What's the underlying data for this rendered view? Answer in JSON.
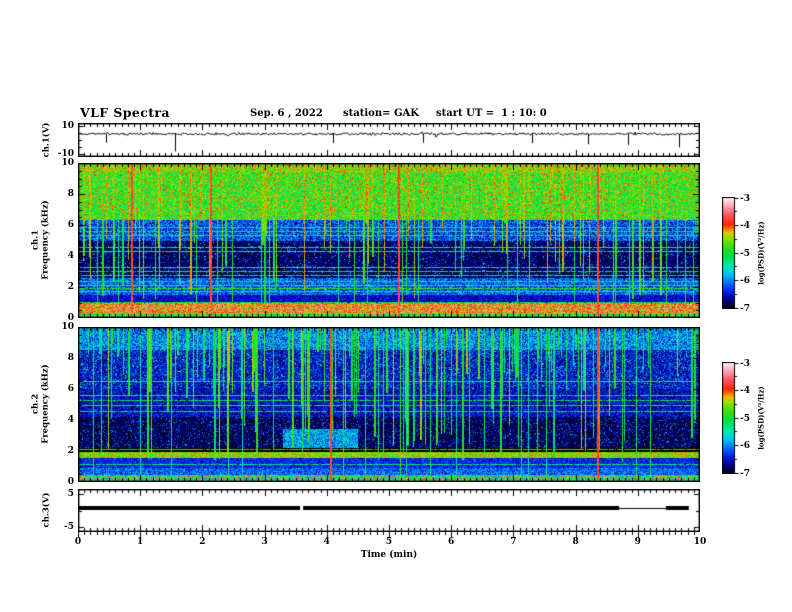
{
  "title": {
    "main": "VLF Spectra",
    "date": "Sep. 6 , 2022",
    "station": "station= GAK",
    "start_ut": "start UT =  1 : 10: 0"
  },
  "x_axis": {
    "label": "Time (min)",
    "ticks": [
      "0",
      "1",
      "2",
      "3",
      "4",
      "5",
      "6",
      "7",
      "8",
      "9",
      "10"
    ],
    "range_min": [
      0,
      10
    ],
    "minor_step_min": 0.1
  },
  "panels": [
    {
      "name": "ch.1 voltage waveform",
      "ylabel": "ch.1(V)",
      "yticks": [
        "10",
        "-10"
      ],
      "y_range": [
        -10,
        10
      ]
    },
    {
      "name": "ch.1 spectrogram",
      "ylabel_line1": "ch.1",
      "ylabel_line2": "Frequency (kHz)",
      "yticks": [
        "10",
        "8",
        "6",
        "4",
        "2",
        "0"
      ],
      "y_range_khz": [
        0,
        10
      ]
    },
    {
      "name": "ch.2 spectrogram",
      "ylabel_line1": "ch.2",
      "ylabel_line2": "Frequency (kHz)",
      "yticks": [
        "10",
        "8",
        "6",
        "4",
        "2",
        "0"
      ],
      "y_range_khz": [
        0,
        10
      ]
    },
    {
      "name": "ch.3 voltage",
      "ylabel": "ch.3(V)",
      "yticks": [
        "5",
        "-5"
      ],
      "y_range": [
        -5,
        5
      ]
    }
  ],
  "colorbars": [
    {
      "label": "log(PSD)(V²/Hz)",
      "ticks": [
        "-3",
        "-4",
        "-5",
        "-6",
        "-7"
      ],
      "range": [
        -7,
        -3
      ]
    },
    {
      "label": "log(PSD)(V²/Hz)",
      "ticks": [
        "-3",
        "-4",
        "-5",
        "-6",
        "-7"
      ],
      "range": [
        -7,
        -3
      ]
    }
  ],
  "colormap": [
    {
      "v": -7.05,
      "c": "#000005"
    },
    {
      "v": -7.0,
      "c": "#000014"
    },
    {
      "v": -6.75,
      "c": "#000080"
    },
    {
      "v": -6.45,
      "c": "#0018e0"
    },
    {
      "v": -6.1,
      "c": "#0070f8"
    },
    {
      "v": -5.8,
      "c": "#00c0f0"
    },
    {
      "v": -5.5,
      "c": "#00e8b0"
    },
    {
      "v": -5.15,
      "c": "#00e050"
    },
    {
      "v": -4.8,
      "c": "#30dc18"
    },
    {
      "v": -4.45,
      "c": "#90e400"
    },
    {
      "v": -4.25,
      "c": "#e8c000"
    },
    {
      "v": -4.1,
      "c": "#ff7000"
    },
    {
      "v": -3.95,
      "c": "#ff2800"
    },
    {
      "v": -3.6,
      "c": "#ff5464"
    },
    {
      "v": -3.3,
      "c": "#ffa0b0"
    },
    {
      "v": -3.0,
      "c": "#ffecf2"
    }
  ],
  "chart_data": [
    {
      "type": "line",
      "name": "ch1_voltage_waveform",
      "x_range_min": [
        0,
        10
      ],
      "y_range_V": [
        -10,
        10
      ],
      "baseline_V": 4.5,
      "noise_amp_V": 1.1,
      "spikes": [
        {
          "t": 0.45,
          "v": -2.0
        },
        {
          "t": 1.56,
          "v": -8.5
        },
        {
          "t": 4.1,
          "v": -2.2
        },
        {
          "t": 5.55,
          "v": -2.0
        },
        {
          "t": 7.3,
          "v": -2.3
        },
        {
          "t": 8.2,
          "v": -3.2
        },
        {
          "t": 8.85,
          "v": -3.6
        },
        {
          "t": 9.66,
          "v": -5.5
        }
      ]
    },
    {
      "type": "heatmap",
      "name": "ch1_spectrogram",
      "x_range_min": [
        0,
        10
      ],
      "f_range_khz": [
        0,
        10
      ],
      "psd_range_log": [
        -7,
        -3
      ],
      "seed": 42,
      "bands": [
        {
          "f": [
            6.3,
            10.0
          ],
          "base": -4.85,
          "noise": 0.55,
          "speckle": {
            "v": -4.1,
            "p": 0.1
          }
        },
        {
          "f": [
            9.4,
            10.0
          ],
          "base": -4.7,
          "noise": 0.6,
          "speckle": {
            "v": -3.6,
            "p": 0.06
          }
        },
        {
          "f": [
            5.0,
            6.3
          ],
          "base": -6.25,
          "noise": 0.5
        },
        {
          "f": [
            2.6,
            5.0
          ],
          "base": -6.8,
          "noise": 0.25,
          "speckle": {
            "v": -5.9,
            "p": 0.06
          }
        },
        {
          "f": [
            1.5,
            2.6
          ],
          "base": -6.15,
          "noise": 0.45
        },
        {
          "f": [
            1.0,
            1.5
          ],
          "base": -6.55,
          "noise": 0.3
        },
        {
          "f": [
            0.35,
            1.0
          ],
          "base": -4.15,
          "noise": 0.5,
          "speckle": {
            "v": -3.4,
            "p": 0.22
          }
        },
        {
          "f": [
            0.0,
            0.35
          ],
          "base": -4.9,
          "noise": 0.7,
          "speckle": {
            "v": -3.7,
            "p": 0.1
          }
        }
      ],
      "hlines": [
        {
          "f": 5.35,
          "v": -4.9
        },
        {
          "f": 5.6,
          "v": -4.9
        },
        {
          "f": 5.9,
          "v": -5.2
        },
        {
          "f": 2.8,
          "v": -5.0
        },
        {
          "f": 3.05,
          "v": -5.1
        },
        {
          "f": 3.3,
          "v": -5.3
        },
        {
          "f": 4.35,
          "v": -5.3
        },
        {
          "f": 4.6,
          "v": -5.4
        },
        {
          "f": 1.75,
          "v": -4.8
        },
        {
          "f": 1.95,
          "v": -4.8
        },
        {
          "f": 2.15,
          "v": -4.9
        },
        {
          "f": 2.4,
          "v": -5.0
        },
        {
          "f": 1.05,
          "v": -5.0
        }
      ],
      "streaks": {
        "count": 95,
        "v": -4.6,
        "noise": 0.4,
        "f_bottom": [
          1.2,
          6.5
        ]
      },
      "short_streaks": {
        "count": 70,
        "v": -4.9,
        "noise": 0.4,
        "f_bottom": [
          6.2,
          8.8
        ]
      },
      "full_lines": {
        "count": 22,
        "v": -5.1,
        "noise": 0.4
      },
      "red_streaks_t_min": [
        0.85,
        2.12,
        5.15,
        8.35
      ]
    },
    {
      "type": "heatmap",
      "name": "ch2_spectrogram",
      "x_range_min": [
        0,
        10
      ],
      "f_range_khz": [
        0,
        10
      ],
      "psd_range_log": [
        -7,
        -3
      ],
      "seed": 77,
      "bands": [
        {
          "f": [
            8.5,
            10.0
          ],
          "base": -6.0,
          "noise": 0.55
        },
        {
          "f": [
            6.0,
            8.5
          ],
          "base": -6.5,
          "noise": 0.4,
          "speckle": {
            "v": -5.6,
            "p": 0.08
          }
        },
        {
          "f": [
            4.2,
            6.0
          ],
          "base": -6.55,
          "noise": 0.4
        },
        {
          "f": [
            2.2,
            4.2
          ],
          "base": -6.85,
          "noise": 0.2,
          "speckle": {
            "v": -6.1,
            "p": 0.12
          }
        },
        {
          "f": [
            1.55,
            1.95
          ],
          "base": -4.5,
          "noise": 0.45
        },
        {
          "f": [
            0.9,
            1.55
          ],
          "base": -6.4,
          "noise": 0.3
        },
        {
          "f": [
            0.45,
            0.9
          ],
          "base": -6.15,
          "noise": 0.4
        },
        {
          "f": [
            0.0,
            0.45
          ],
          "base": -5.2,
          "noise": 0.9,
          "speckle": {
            "v": -3.6,
            "p": 0.18
          }
        }
      ],
      "patches": [
        {
          "t": [
            3.3,
            4.5
          ],
          "f": [
            2.2,
            3.4
          ],
          "base": -5.9,
          "noise": 0.5
        }
      ],
      "hlines": [
        {
          "f": 4.6,
          "v": -5.0
        },
        {
          "f": 4.95,
          "v": -5.0
        },
        {
          "f": 5.3,
          "v": -5.1
        },
        {
          "f": 5.6,
          "v": -5.2
        },
        {
          "f": 6.5,
          "v": -5.6
        },
        {
          "f": 2.1,
          "v": -5.0
        },
        {
          "f": 1.15,
          "v": -5.3
        }
      ],
      "streaks": {
        "count": 110,
        "v": -4.8,
        "noise": 0.45,
        "f_bottom": [
          1.3,
          7.0
        ]
      },
      "short_streaks": {
        "count": 50,
        "v": -5.2,
        "noise": 0.4,
        "f_bottom": [
          7.0,
          9.0
        ]
      },
      "full_lines": {
        "count": 18,
        "v": -5.2,
        "noise": 0.4
      },
      "red_streaks_t_min": [
        4.05,
        8.35
      ]
    },
    {
      "type": "line",
      "name": "ch3_voltage_state",
      "x_range_min": [
        0,
        10
      ],
      "y_range_V": [
        -5,
        5
      ],
      "segments": [
        {
          "t": [
            0.0,
            3.57
          ],
          "v": 0.7,
          "lw": 4
        },
        {
          "t": [
            3.62,
            8.7
          ],
          "v": 0.7,
          "lw": 4
        },
        {
          "t": [
            8.7,
            9.45
          ],
          "v": 0.7,
          "lw": 1
        },
        {
          "t": [
            9.45,
            9.82
          ],
          "v": 0.7,
          "lw": 4
        }
      ]
    }
  ]
}
